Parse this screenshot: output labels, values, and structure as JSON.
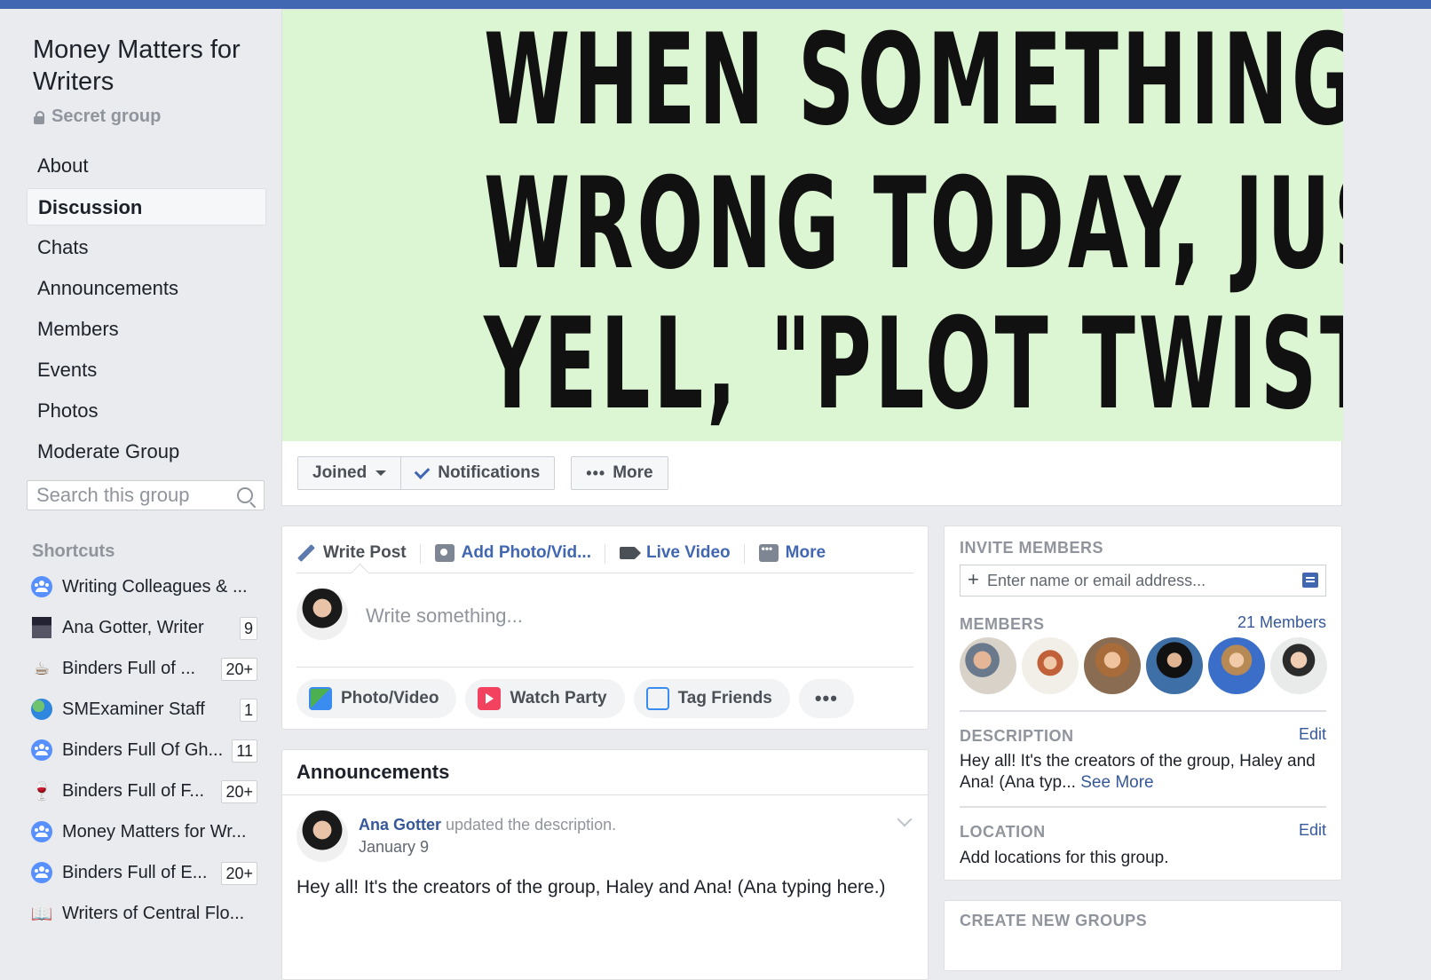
{
  "group": {
    "title": "Money Matters for Writers",
    "privacy": "Secret group"
  },
  "nav": {
    "items": [
      {
        "label": "About"
      },
      {
        "label": "Discussion",
        "active": true
      },
      {
        "label": "Chats"
      },
      {
        "label": "Announcements"
      },
      {
        "label": "Members"
      },
      {
        "label": "Events"
      },
      {
        "label": "Photos"
      },
      {
        "label": "Moderate Group"
      }
    ]
  },
  "search": {
    "placeholder": "Search this group"
  },
  "shortcuts": {
    "title": "Shortcuts",
    "items": [
      {
        "label": "Writing Colleagues & ...",
        "badge": "",
        "icon": "group-icon"
      },
      {
        "label": "Ana Gotter, Writer",
        "badge": "9",
        "icon": "page-photo-icon"
      },
      {
        "label": "Binders Full of ...",
        "badge": "20+",
        "icon": "coffee-icon"
      },
      {
        "label": "SMExaminer Staff",
        "badge": "1",
        "icon": "globe-icon"
      },
      {
        "label": "Binders Full Of Gh...",
        "badge": "11",
        "icon": "group-icon"
      },
      {
        "label": "Binders Full of F...",
        "badge": "20+",
        "icon": "wine-icon"
      },
      {
        "label": "Money Matters for Wr...",
        "badge": "",
        "icon": "group-icon"
      },
      {
        "label": "Binders Full of E...",
        "badge": "20+",
        "icon": "group-icon"
      },
      {
        "label": "Writers of Central Flo...",
        "badge": "",
        "icon": "book-icon"
      }
    ]
  },
  "cover": {
    "lines": [
      "WHEN SOMETHING GOES",
      "WRONG TODAY, JUST",
      "YELL, \"PLOT TWIST!\""
    ],
    "background": "#dcf5d3"
  },
  "actions": {
    "joined": "Joined",
    "notifications": "Notifications",
    "more": "More"
  },
  "composer": {
    "tabs": {
      "write_post": "Write Post",
      "add_photo": "Add Photo/Vid...",
      "live_video": "Live Video",
      "more": "More"
    },
    "placeholder": "Write something...",
    "buttons": {
      "photo_video": "Photo/Video",
      "watch_party": "Watch Party",
      "tag_friends": "Tag Friends",
      "dots": "•••"
    }
  },
  "announcements": {
    "title": "Announcements",
    "author": "Ana Gotter",
    "action": " updated the description.",
    "date": "January 9",
    "text": "Hey all! It's the creators of the group, Haley and Ana! (Ana typing here.)"
  },
  "right": {
    "invite_label": "INVITE MEMBERS",
    "invite_placeholder": "Enter name or email address...",
    "members_label": "MEMBERS",
    "members_count": "21 Members",
    "description_label": "DESCRIPTION",
    "description_edit": "Edit",
    "description_text": "Hey all! It's the creators of the group, Haley and Ana! (Ana typ...",
    "see_more": "See More",
    "location_label": "LOCATION",
    "location_edit": "Edit",
    "location_text": "Add locations for this group.",
    "create_label": "CREATE NEW GROUPS"
  },
  "colors": {
    "brand": "#4267b2",
    "link": "#365899",
    "page_bg": "#e9ebee"
  }
}
